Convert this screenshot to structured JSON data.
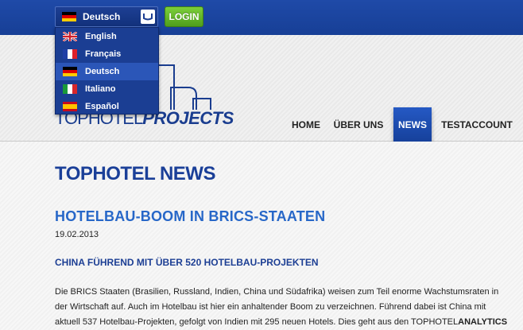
{
  "topbar": {
    "language_selected": "Deutsch",
    "login_label": "LOGIN"
  },
  "language_menu": {
    "items": [
      {
        "label": "English",
        "flag": "uk-flag-icon"
      },
      {
        "label": "Français",
        "flag": "france-flag-icon"
      },
      {
        "label": "Deutsch",
        "flag": "germany-flag-icon",
        "active": true
      },
      {
        "label": "Italiano",
        "flag": "italy-flag-icon"
      },
      {
        "label": "Español",
        "flag": "spain-flag-icon"
      }
    ]
  },
  "logo": {
    "part1": "TOPHOTEL",
    "part2": "PROJECTS"
  },
  "nav": {
    "items": [
      {
        "label": "HOME"
      },
      {
        "label": "ÜBER UNS"
      },
      {
        "label": "NEWS",
        "active": true
      },
      {
        "label": "TESTACCOUNT"
      }
    ]
  },
  "content": {
    "section_title": "TOPHOTEL NEWS",
    "article_title": "HOTELBAU-BOOM IN BRICS-STAATEN",
    "article_date": "19.02.2013",
    "article_subtitle": "CHINA FÜHREND MIT ÜBER 520 HOTELBAU-PROJEKTEN",
    "body_lines": [
      "Die BRICS Staaten (Brasilien, Russland, Indien, China und Südafrika) weisen zum Teil enorme Wachstumsraten in",
      "der Wirtschaft auf. Auch im Hotelbau ist hier ein anhaltender Boom zu verzeichnen. Führend dabei ist China mit",
      "aktuell 537 Hotelbau-Projekten, gefolgt von Indien mit 295 neuen Hotels. Dies geht aus den TOPHOTEL"
    ],
    "body_highlight": "ANALYTICS"
  },
  "colors": {
    "brand_blue": "#1a3f98",
    "title_blue": "#2767c8",
    "login_green": "#5cae24"
  }
}
